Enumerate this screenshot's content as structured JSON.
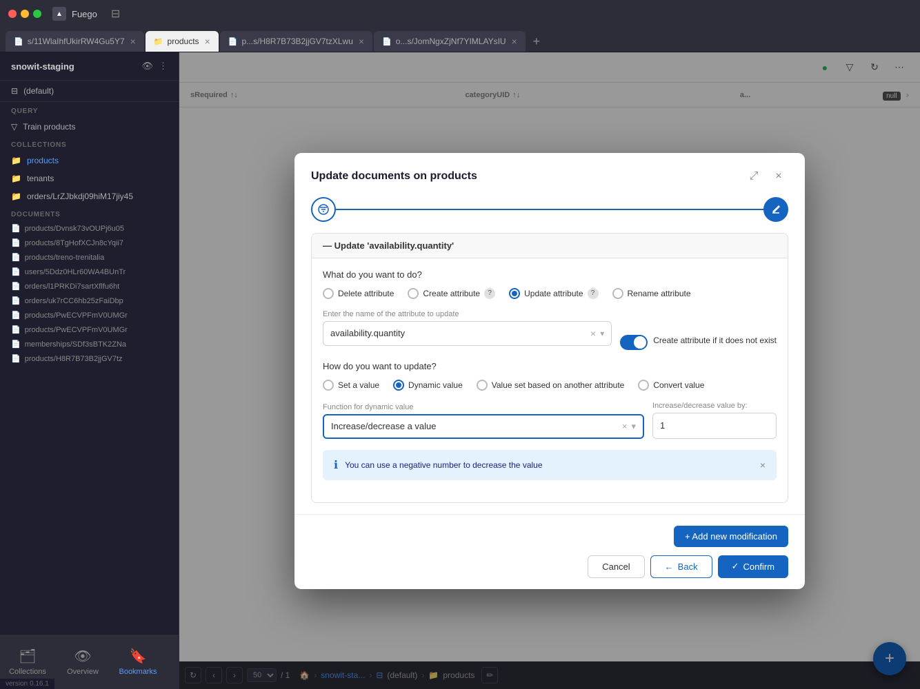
{
  "titlebar": {
    "app_name": "Fuego",
    "sidebar_toggle": "⊟"
  },
  "tabs": [
    {
      "id": "tab1",
      "label": "s/11WlaIhfUkirRW4Gu5Y7",
      "active": false,
      "icon": "📄"
    },
    {
      "id": "tab2",
      "label": "products",
      "active": true,
      "icon": "📁"
    },
    {
      "id": "tab3",
      "label": "p...s/H8R7B73B2jjGV7tzXLwu",
      "active": false,
      "icon": "📄"
    },
    {
      "id": "tab4",
      "label": "o...s/JomNgxZjNf7YIMLAYsIU",
      "active": false,
      "icon": "📄"
    }
  ],
  "sidebar": {
    "workspace": "snowit-staging",
    "database": "(default)",
    "query_section": "QUERY",
    "query_item": "Train products",
    "collections_section": "COLLECTIONS",
    "collections": [
      {
        "id": "products",
        "label": "products",
        "active": true,
        "icon": "📁"
      },
      {
        "id": "tenants",
        "label": "tenants",
        "active": false,
        "icon": "📁"
      },
      {
        "id": "orders",
        "label": "orders/LrZJbkdj09hiM17jiy45",
        "active": false,
        "icon": "📁"
      }
    ],
    "documents_section": "DOCUMENTS",
    "documents": [
      "products/Dvnsk73vOUPj6u05",
      "products/8TgHofXCJn8cYqii7",
      "products/treno-trenitalia",
      "users/5Ddz0HLr60WA4BUnTr",
      "orders/l1PRKDi7sartXflfu6ht",
      "orders/uk7rCC6hb25zFaiDbp",
      "products/PwECVPFmV0UMGr",
      "products/PwECVPFmV0UMGr",
      "memberships/SDf3sBTK2ZNa",
      "products/H8R7B73B2jjGV7tz"
    ]
  },
  "table": {
    "columns": [
      {
        "label": "sRequired",
        "sort": true
      },
      {
        "label": "categoryUID",
        "sort": true
      },
      {
        "label": "a..."
      }
    ],
    "null_badge": "null"
  },
  "modal": {
    "title": "Update documents on products",
    "stepper": {
      "step1_icon": "⊕",
      "step2_icon": "✏️"
    },
    "mod_card_header": "— Update 'availability.quantity'",
    "what_label": "What do you want to do?",
    "actions": [
      {
        "id": "delete",
        "label": "Delete attribute",
        "checked": false
      },
      {
        "id": "create",
        "label": "Create attribute",
        "checked": false
      },
      {
        "id": "update",
        "label": "Update attribute",
        "checked": true
      },
      {
        "id": "rename",
        "label": "Rename attribute",
        "checked": false
      }
    ],
    "attr_input_label": "Enter the name of the attribute to update",
    "attr_input_value": "availability.quantity",
    "toggle_label": "Create attribute if it does not exist",
    "how_label": "How do you want to update?",
    "update_methods": [
      {
        "id": "set",
        "label": "Set a value",
        "checked": false
      },
      {
        "id": "dynamic",
        "label": "Dynamic value",
        "checked": true
      },
      {
        "id": "value_set",
        "label": "Value set based on another attribute",
        "checked": false
      },
      {
        "id": "convert",
        "label": "Convert value",
        "checked": false
      }
    ],
    "function_label": "Function for dynamic value",
    "function_value": "Increase/decrease a value",
    "increase_label": "Increase/decrease value by:",
    "increase_value": "1",
    "info_message": "You can use a negative number to decrease the value",
    "add_mod_label": "+ Add new modification",
    "cancel_label": "Cancel",
    "back_label": "Back",
    "confirm_label": "Confirm"
  },
  "bottom_bar": {
    "page_size": "50",
    "page_info": "/ 1",
    "breadcrumbs": [
      "snowit-sta...",
      "(default)",
      "products"
    ]
  },
  "bottom_nav": [
    {
      "id": "collections",
      "label": "Collections",
      "icon": "🗂",
      "active": false
    },
    {
      "id": "overview",
      "label": "Overview",
      "icon": "👁",
      "active": false
    },
    {
      "id": "bookmarks",
      "label": "Bookmarks",
      "icon": "🔖",
      "active": true
    }
  ],
  "version": "version 0.16.1",
  "fab_label": "+"
}
